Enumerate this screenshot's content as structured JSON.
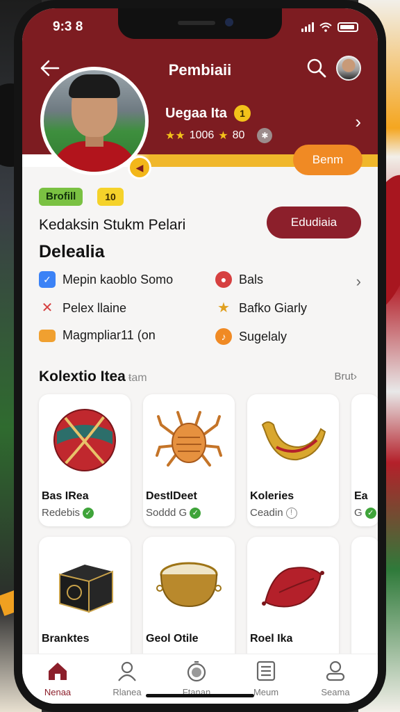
{
  "status": {
    "time": "9:3 8"
  },
  "header": {
    "title": "Pembiaii",
    "orange_button": "Benm"
  },
  "profile": {
    "name": "Uegaa Ita",
    "level": "1",
    "stat_a": "1006",
    "stat_b": "80"
  },
  "info": {
    "tag_green": "Brofill",
    "tag_yellow": "10",
    "subtitle": "Kedaksin Stukm Pelari",
    "title": "Delealia",
    "edit_button": "Edudiaia",
    "attributes": [
      {
        "label": "Mepin kaoblo Somo",
        "icon": "check-shield-icon",
        "color": "#3b82f6"
      },
      {
        "label": "Bals",
        "icon": "ball-icon",
        "color": "#d64040"
      },
      {
        "label": "Pelex llaine",
        "icon": "cross-bones-icon",
        "color": "#d64040"
      },
      {
        "label": "Bafko Giarly",
        "icon": "trophy-icon",
        "color": "#e0a020"
      },
      {
        "label": "Magmpliar11 (on",
        "icon": "card-icon",
        "color": "#f0a030"
      },
      {
        "label": "Sugelaly",
        "icon": "music-icon",
        "color": "#f08a24"
      }
    ]
  },
  "collection": {
    "title": "Kolextio Itea",
    "subtitle": "ŧam",
    "see_all": "Brut",
    "items": [
      {
        "name": "Bas IRea",
        "meta": "Redebis",
        "status": "verified"
      },
      {
        "name": "DestlDeet",
        "meta": "Soddd G",
        "status": "verified"
      },
      {
        "name": "Koleries",
        "meta": "Ceadin",
        "status": "pending"
      },
      {
        "name": "Ea",
        "meta": "G",
        "status": "verified"
      },
      {
        "name": "Branktes",
        "meta": "",
        "status": ""
      },
      {
        "name": "Geol Otile",
        "meta": "",
        "status": ""
      },
      {
        "name": "Roel Ika",
        "meta": "",
        "status": ""
      }
    ]
  },
  "nav": {
    "items": [
      {
        "label": "Nenaa",
        "icon": "home-icon"
      },
      {
        "label": "Rlanea",
        "icon": "user-icon"
      },
      {
        "label": "Ftanan",
        "icon": "stopwatch-icon"
      },
      {
        "label": "Meum",
        "icon": "list-icon"
      },
      {
        "label": "Seama",
        "icon": "profile-icon"
      }
    ],
    "active": "Nenaa"
  },
  "colors": {
    "maroon": "#7d1c21",
    "gold": "#f0b72b",
    "orange": "#f08a24",
    "button": "#8c1f2b"
  }
}
